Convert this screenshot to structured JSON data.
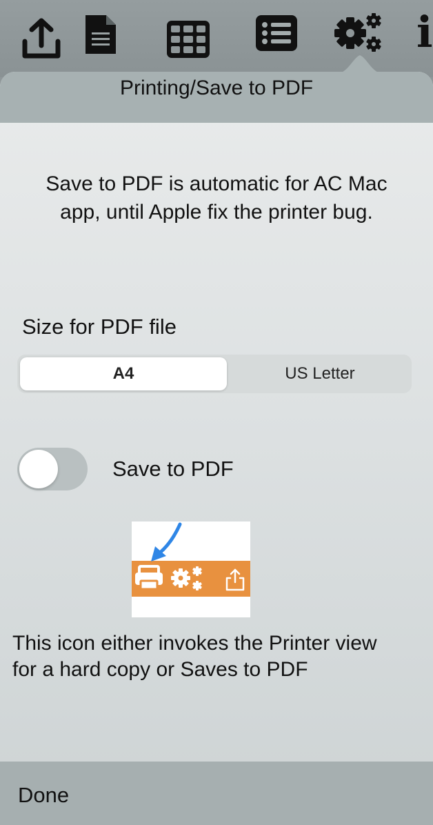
{
  "toolbar": {
    "icons": [
      "share-upload-icon",
      "document-icon",
      "grid-icon",
      "list-icon",
      "settings-gears-icon",
      "info-icon"
    ],
    "info_glyph": "i"
  },
  "popover": {
    "title": "Printing/Save to PDF",
    "info_line_1": "Save to PDF is automatic for AC Mac",
    "info_line_2": "app, until Apple fix the printer bug.",
    "size_label": "Size for PDF file",
    "size_options": [
      "A4",
      "US Letter"
    ],
    "size_selected": "A4",
    "toggle_label": "Save to PDF",
    "toggle_on": false,
    "help_line_1": "This icon either invokes the Printer view",
    "help_line_2": "for a hard copy or Saves to PDF",
    "done_label": "Done"
  },
  "colors": {
    "toolbar_bg": "#8f9799",
    "header_bg": "#a7b1b2",
    "footer_bg": "#a6afb0",
    "example_banner": "#e8913f",
    "example_arrow": "#2f86e6"
  }
}
